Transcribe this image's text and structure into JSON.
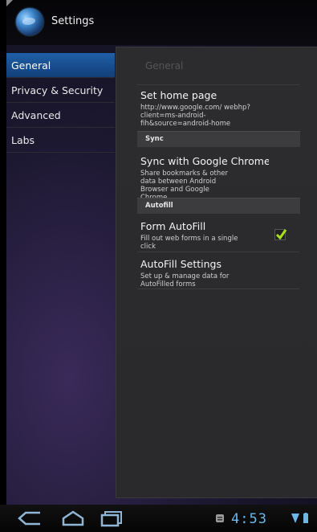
{
  "app": {
    "title": "Settings"
  },
  "sidebar": {
    "items": [
      {
        "label": "General"
      },
      {
        "label": "Privacy & Security"
      },
      {
        "label": "Advanced"
      },
      {
        "label": "Labs"
      }
    ]
  },
  "panel": {
    "title": "General",
    "home_page": {
      "title": "Set home page",
      "summary": "http://www.google.com/ webhp?client=ms-android-fih&source=android-home"
    },
    "sync_header": "Sync",
    "sync": {
      "title": "Sync with Google Chrome",
      "summary": "Share bookmarks & other data between Android Browser and Google Chrome"
    },
    "autofill_header": "Autofill",
    "form_autofill": {
      "title": "Form AutoFill",
      "summary": "Fill out web forms in a single click",
      "checked": true
    },
    "autofill_settings": {
      "title": "AutoFill Settings",
      "summary": "Set up & manage data for AutoFilled forms"
    }
  },
  "statusbar": {
    "time": "4:53",
    "accent_color": "#6bb7e8"
  },
  "colors": {
    "selected_item": "#1f5fa8",
    "checkbox_check": "#a8e020"
  }
}
